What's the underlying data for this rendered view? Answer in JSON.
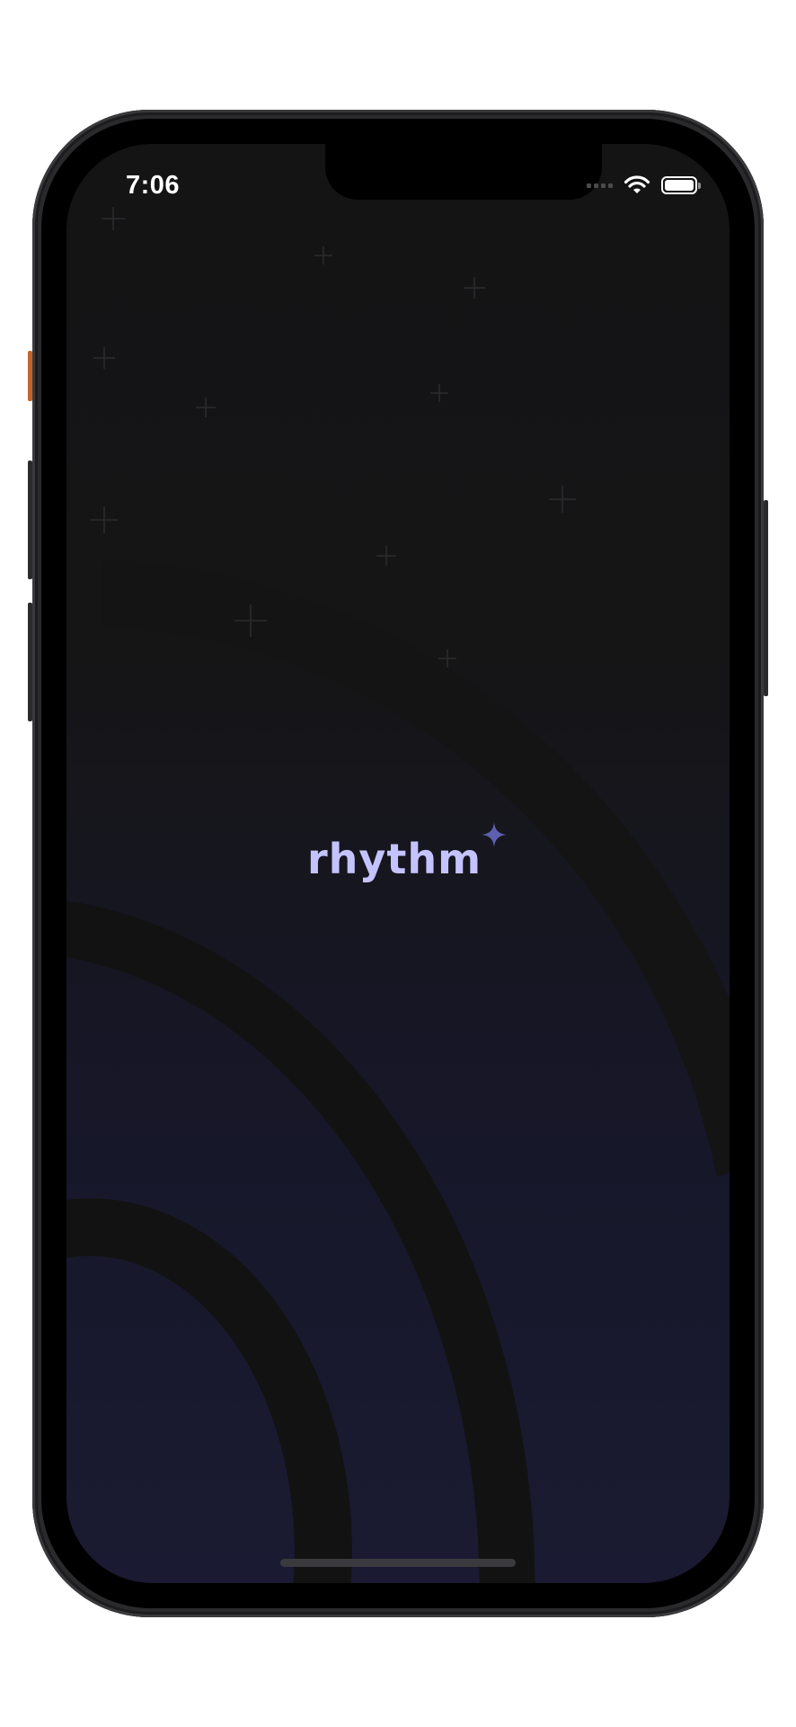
{
  "status_bar": {
    "time": "7:06",
    "icons": [
      "cellular-signal-icon",
      "wifi-icon",
      "battery-icon"
    ]
  },
  "splash": {
    "logo_text": "rhythm",
    "logo_sparkle_icon": "sparkle-icon"
  },
  "colors": {
    "logo_text": "#c4c3ff",
    "sparkle": "#5e5fb0",
    "background_top": "#141415",
    "background_bottom": "#1a1b32",
    "arc_band": "#131313"
  }
}
